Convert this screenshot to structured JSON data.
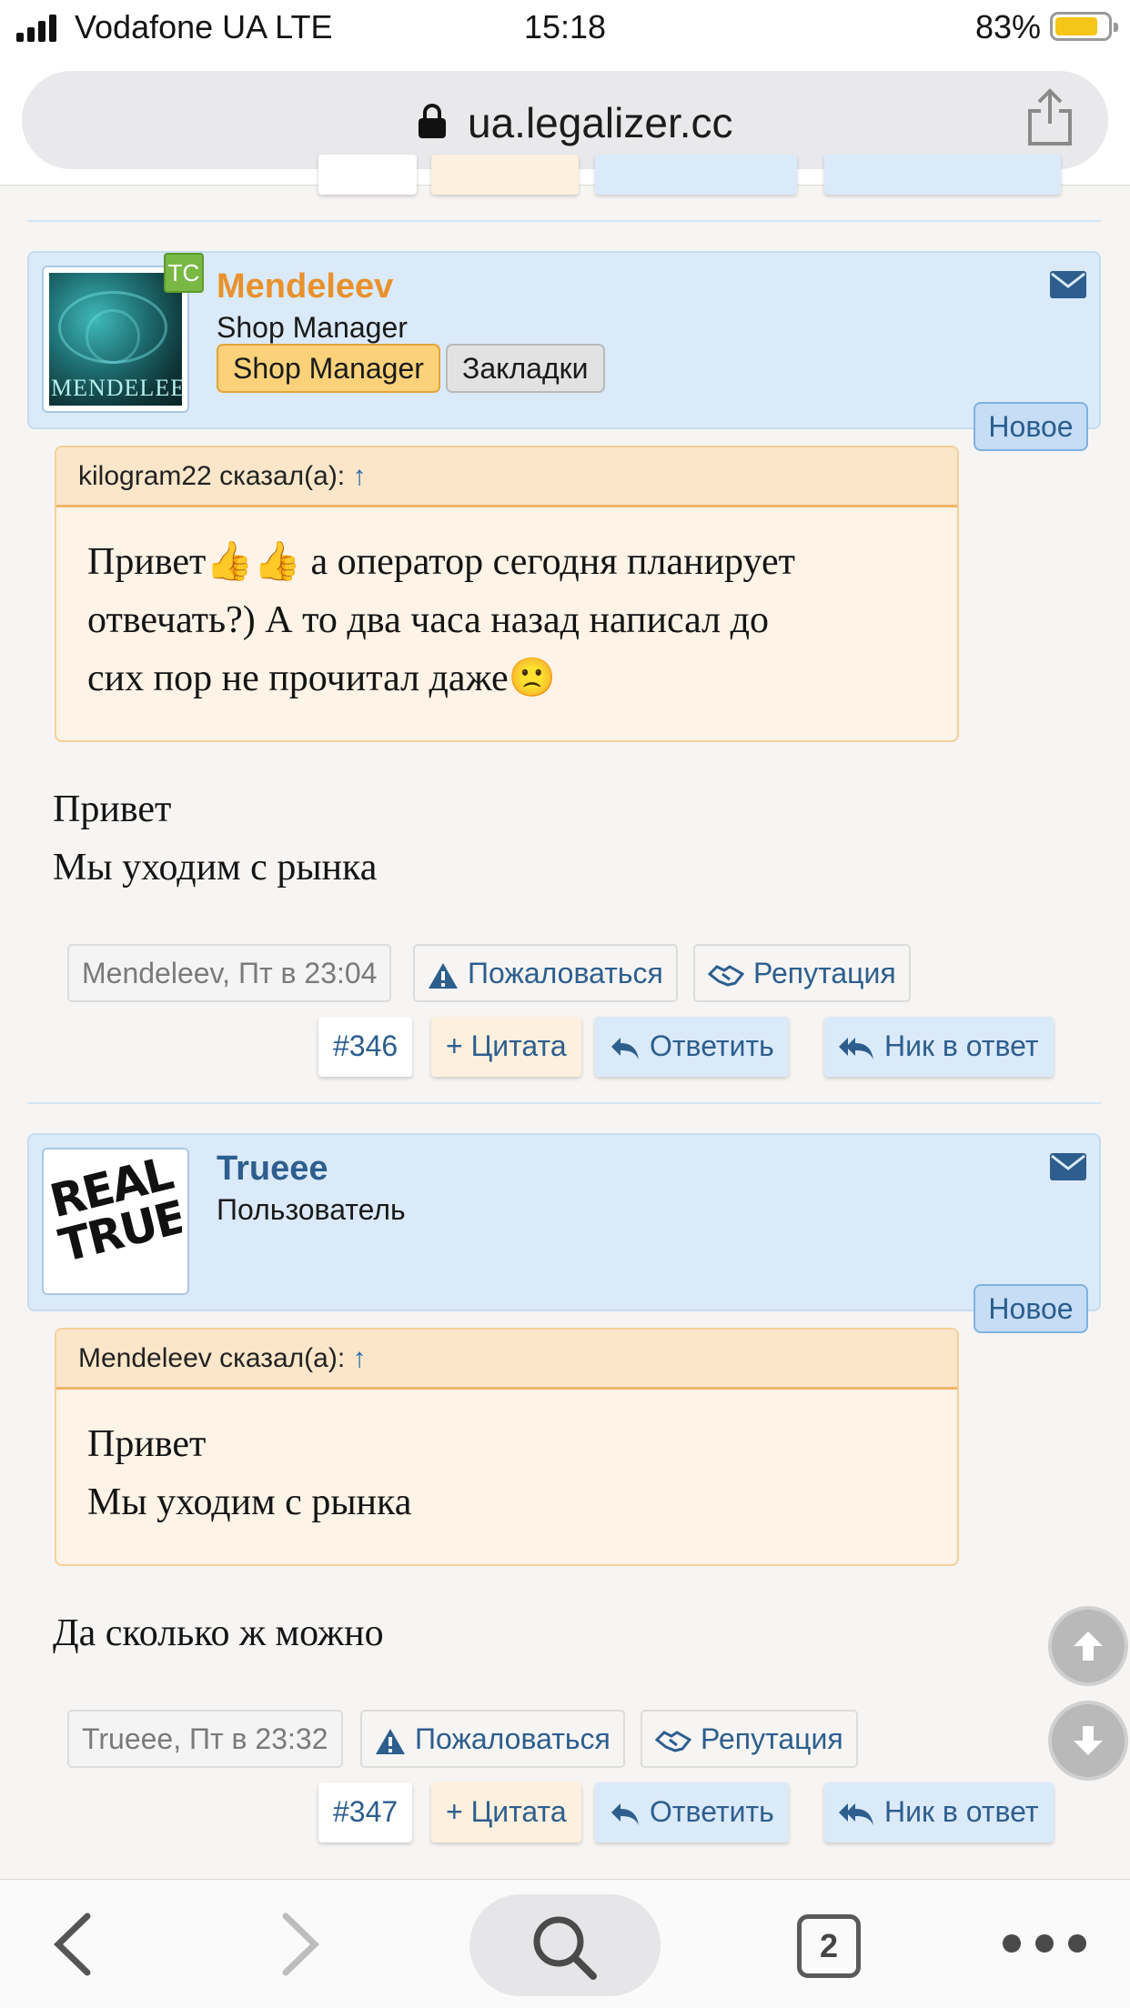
{
  "status_bar": {
    "carrier": "Vodafone UA LTE",
    "time": "15:18",
    "battery": "83%"
  },
  "browser": {
    "url": "ua.legalizer.cc",
    "tabs_count": "2"
  },
  "posts": [
    {
      "username": "Mendeleev",
      "username_color": "#e8912d",
      "badge": "TC",
      "user_title": "Shop Manager",
      "buttons": [
        "Shop Manager",
        "Закладки"
      ],
      "new_label": "Новое",
      "quote_author": "kilogram22 сказал(а):",
      "quote_arrow": "↑",
      "quote_lines": [
        "Привет👍👍 а оператор сегодня планирует",
        "отвечать?) А то два часа назад написал до",
        "сих пор не прочитал даже🙁"
      ],
      "message_lines": [
        "Привет",
        "Мы уходим с рынка"
      ],
      "meta_author": "Mendeleev",
      "meta_time": ", Пт в 23:04",
      "report": "Пожаловаться",
      "reputation": "Репутация",
      "post_number": "#346",
      "quote_btn": "+ Цитата",
      "reply_btn": "Ответить",
      "nick_btn": "Ник в ответ",
      "avatar_text": "MENDELEEV"
    },
    {
      "username": "Trueee",
      "username_color": "#2d5e8e",
      "user_title": "Пользователь",
      "new_label": "Новое",
      "quote_author": "Mendeleev сказал(а):",
      "quote_arrow": "↑",
      "quote_lines": [
        "Привет",
        "Мы уходим с рынка"
      ],
      "message_lines": [
        "Да сколько ж можно"
      ],
      "meta_author": "Trueee",
      "meta_time": ", Пт в 23:32",
      "report": "Пожаловаться",
      "reputation": "Репутация",
      "post_number": "#347",
      "quote_btn": "+ Цитата",
      "reply_btn": "Ответить",
      "nick_btn": "Ник в ответ",
      "avatar_lines": [
        "REAL",
        "TRUE"
      ]
    }
  ]
}
